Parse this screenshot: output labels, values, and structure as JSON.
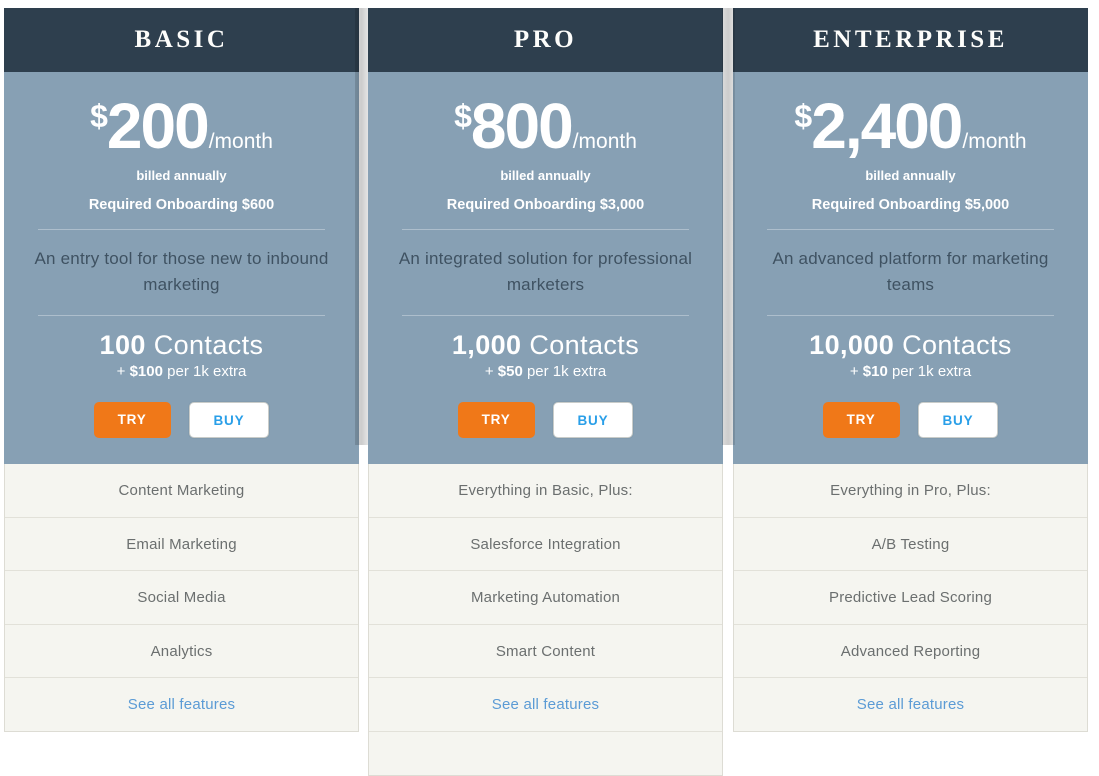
{
  "theme": {
    "header_bg": "#2e3f4e",
    "body_bg": "#87a0b4",
    "feature_bg": "#f5f5f0",
    "try_button_bg": "#f07818",
    "buy_button_text": "#2a9fe8",
    "link_color": "#5b9bd5"
  },
  "plans": [
    {
      "id": "basic",
      "title": "BASIC",
      "currency": "$",
      "amount": "200",
      "period": "/month",
      "billing_note": "billed annually",
      "onboarding_note": "Required Onboarding $600",
      "description": "An entry tool for those new to inbound marketing",
      "contacts_count": "100",
      "contacts_word": "Contacts",
      "contacts_extra_prefix": "+ ",
      "contacts_extra_price": "$100",
      "contacts_extra_suffix": " per 1k extra",
      "try_label": "TRY",
      "buy_label": "BUY",
      "features": [
        "Content Marketing",
        "Email Marketing",
        "Social Media",
        "Analytics"
      ],
      "see_all_label": "See all features"
    },
    {
      "id": "pro",
      "title": "PRO",
      "currency": "$",
      "amount": "800",
      "period": "/month",
      "billing_note": "billed annually",
      "onboarding_note": "Required Onboarding $3,000",
      "description": "An integrated solution for professional marketers",
      "contacts_count": "1,000",
      "contacts_word": "Contacts",
      "contacts_extra_prefix": "+ ",
      "contacts_extra_price": "$50",
      "contacts_extra_suffix": " per 1k extra",
      "try_label": "TRY",
      "buy_label": "BUY",
      "features": [
        "Everything in Basic, Plus:",
        "Salesforce Integration",
        "Marketing Automation",
        "Smart Content"
      ],
      "see_all_label": "See all features"
    },
    {
      "id": "enterprise",
      "title": "ENTERPRISE",
      "currency": "$",
      "amount": "2,400",
      "period": "/month",
      "billing_note": "billed annually",
      "onboarding_note": "Required Onboarding $5,000",
      "description": "An advanced platform for marketing teams",
      "contacts_count": "10,000",
      "contacts_word": "Contacts",
      "contacts_extra_prefix": "+ ",
      "contacts_extra_price": "$10",
      "contacts_extra_suffix": " per 1k extra",
      "try_label": "TRY",
      "buy_label": "BUY",
      "features": [
        "Everything in Pro, Plus:",
        "A/B Testing",
        "Predictive Lead Scoring",
        "Advanced Reporting"
      ],
      "see_all_label": "See all features"
    }
  ]
}
